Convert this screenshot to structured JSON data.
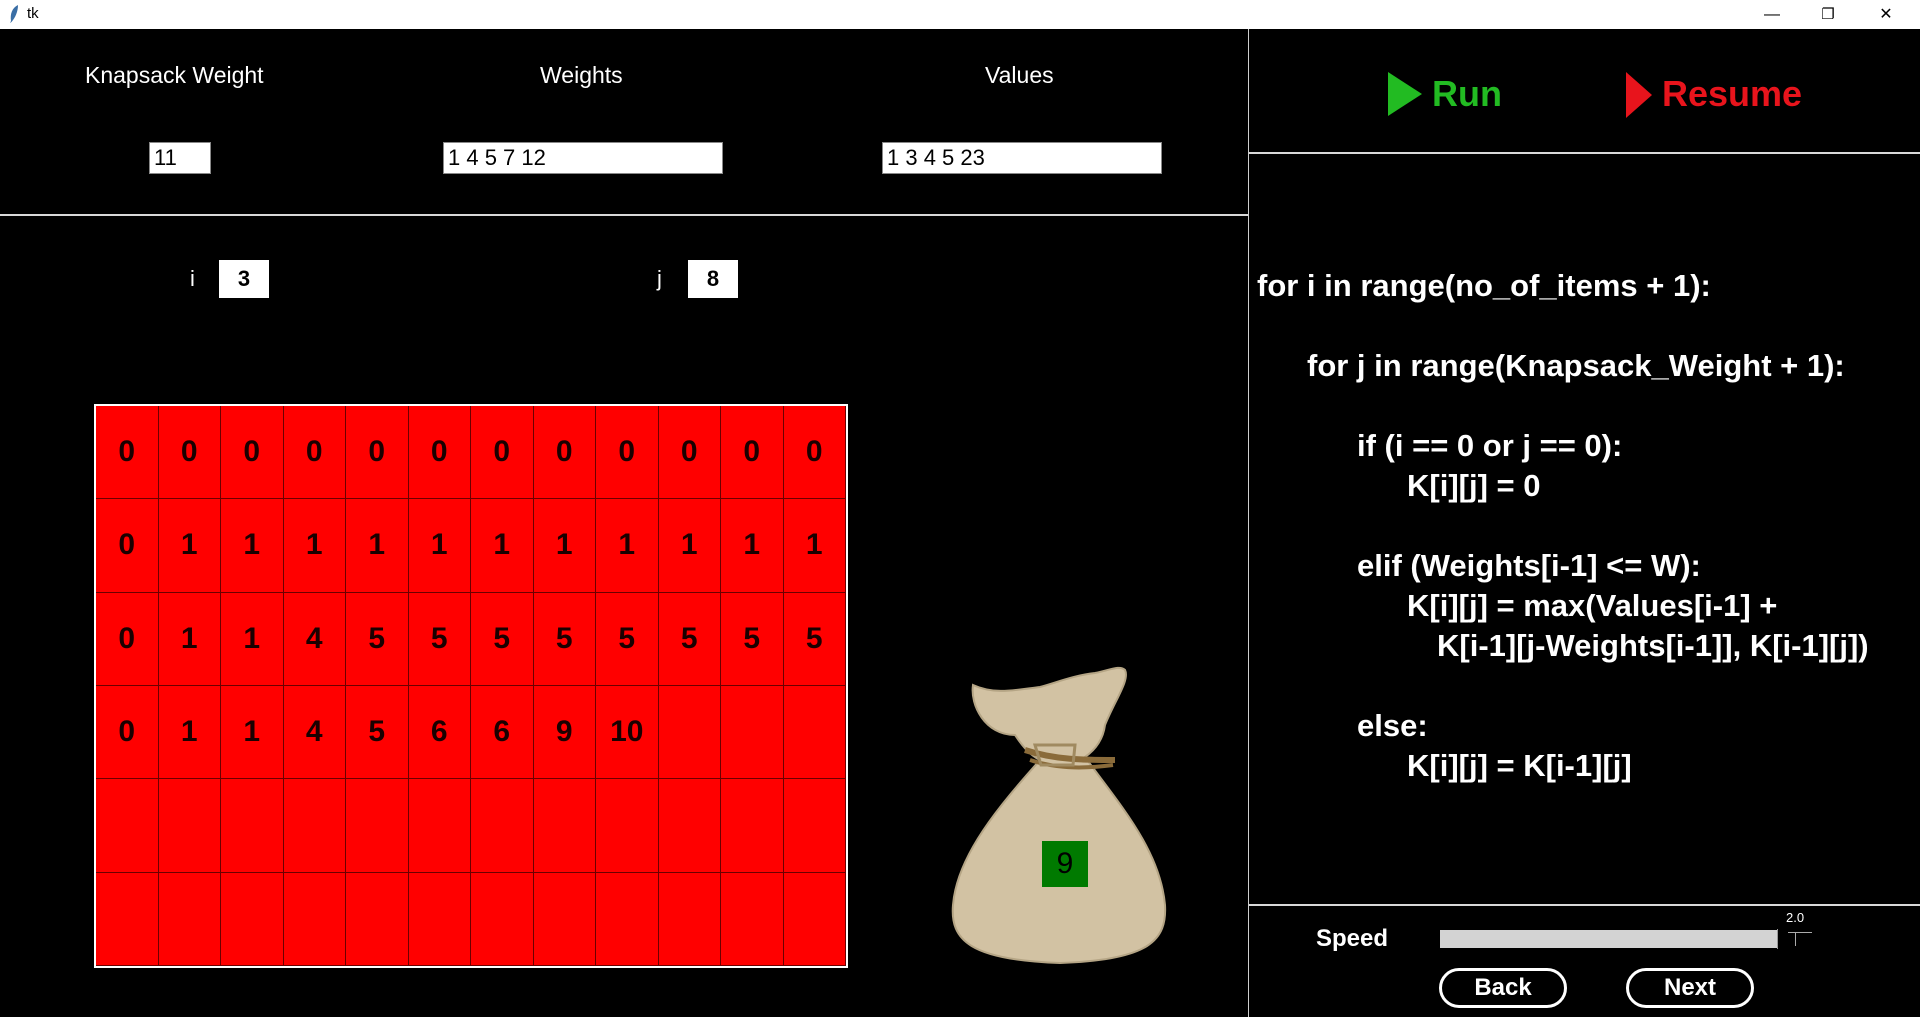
{
  "window": {
    "title": "tk",
    "minimize_glyph": "—",
    "restore_glyph": "❐",
    "close_glyph": "✕"
  },
  "inputs": {
    "knapsack_weight_label": "Knapsack Weight",
    "knapsack_weight_value": "11",
    "weights_label": "Weights",
    "weights_value": "1 4 5 7 12",
    "values_label": "Values",
    "values_value": "1 3 4 5 23"
  },
  "indices": {
    "i_label": "i",
    "i_value": "3",
    "j_label": "j",
    "j_value": "8"
  },
  "table": {
    "rows": [
      [
        "0",
        "0",
        "0",
        "0",
        "0",
        "0",
        "0",
        "0",
        "0",
        "0",
        "0",
        "0"
      ],
      [
        "0",
        "1",
        "1",
        "1",
        "1",
        "1",
        "1",
        "1",
        "1",
        "1",
        "1",
        "1"
      ],
      [
        "0",
        "1",
        "1",
        "4",
        "5",
        "5",
        "5",
        "5",
        "5",
        "5",
        "5",
        "5"
      ],
      [
        "0",
        "1",
        "1",
        "4",
        "5",
        "6",
        "6",
        "9",
        "10",
        "",
        "",
        ""
      ],
      [
        "",
        "",
        "",
        "",
        "",
        "",
        "",
        "",
        "",
        "",
        "",
        ""
      ],
      [
        "",
        "",
        "",
        "",
        "",
        "",
        "",
        "",
        "",
        "",
        "",
        ""
      ]
    ],
    "cell_color": "#ff0000"
  },
  "bag": {
    "value": "9",
    "value_color": "#007a00",
    "bag_color": "#d2c2a3"
  },
  "controls": {
    "run_label": "Run",
    "resume_label": "Resume",
    "run_color": "#22bb22",
    "resume_color": "#e8141c"
  },
  "code": {
    "line1": "for i in range(no_of_items + 1):",
    "line2": "for j in range(Knapsack_Weight + 1):",
    "line3": "if (i == 0 or j == 0):",
    "line4": "K[i][j] = 0",
    "line5": "elif (Weights[i-1] <= W):",
    "line6": "K[i][j] = max(Values[i-1] +",
    "line7": "K[i-1][j-Weights[i-1]], K[i-1][j])",
    "line8": "else:",
    "line9": "K[i][j] = K[i-1][j]"
  },
  "speed": {
    "label": "Speed",
    "value": "2.0",
    "level_fraction": 1.0
  },
  "nav": {
    "back_label": "Back",
    "next_label": "Next"
  }
}
